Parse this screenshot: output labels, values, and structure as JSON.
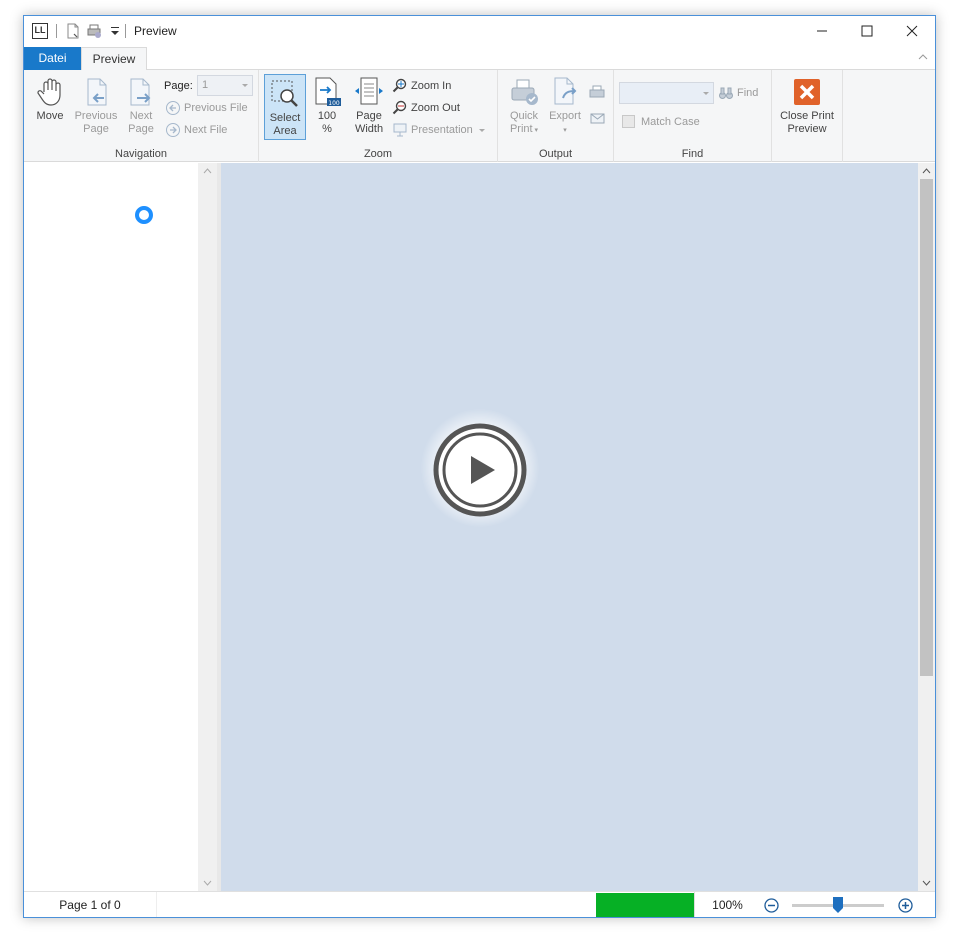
{
  "window": {
    "title": "Preview",
    "logo_text": "LL"
  },
  "tabs": {
    "file": "Datei",
    "preview": "Preview"
  },
  "ribbon": {
    "navigation": {
      "label": "Navigation",
      "move": "Move",
      "previous_page": [
        "Previous",
        "Page"
      ],
      "next_page": [
        "Next",
        "Page"
      ],
      "page_label": "Page:",
      "page_value": "1",
      "previous_file": "Previous File",
      "next_file": "Next File"
    },
    "zoom": {
      "label": "Zoom",
      "select_area": [
        "Select",
        "Area"
      ],
      "hundred": [
        "100",
        "%"
      ],
      "page_width": [
        "Page",
        "Width"
      ],
      "zoom_in": "Zoom In",
      "zoom_out": "Zoom Out",
      "presentation": "Presentation"
    },
    "output": {
      "label": "Output",
      "quick_print": [
        "Quick",
        "Print"
      ],
      "export": [
        "Export",
        ""
      ]
    },
    "find": {
      "label": "Find",
      "find_button": "Find",
      "match_case": "Match Case",
      "search_value": ""
    },
    "close": {
      "label": [
        "Close Print",
        "Preview"
      ]
    }
  },
  "status": {
    "page_text": "Page 1 of 0",
    "progress_percent": 100,
    "zoom_text": "100%",
    "zoom_slider_fraction": 0.5
  },
  "colors": {
    "accent": "#1979ca",
    "progress": "#06b025",
    "preview_bg": "#d0dceb",
    "close_icon": "#e0622a"
  }
}
